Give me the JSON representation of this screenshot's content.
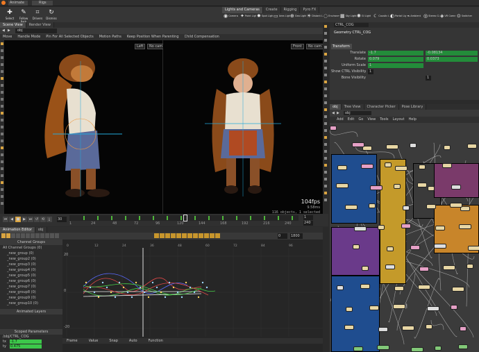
{
  "menubar": {
    "project": "Animate",
    "desktop": "Rigs"
  },
  "shelf": {
    "tools": [
      {
        "icon": "✚",
        "label": "Select"
      },
      {
        "icon": "✎",
        "label": "Follow Path"
      },
      {
        "icon": "⌗",
        "label": "Drivers"
      },
      {
        "icon": "↻",
        "label": "Dismiss"
      }
    ],
    "light_tabs": [
      "Lights and Cameras",
      "Create",
      "Rigging",
      "Pyro FX"
    ],
    "lights": [
      {
        "icon": "◉",
        "label": "Camera"
      },
      {
        "icon": "✦",
        "label": "Point Light"
      },
      {
        "icon": "✸",
        "label": "Spot Light"
      },
      {
        "icon": "▭",
        "label": "Area Light"
      },
      {
        "icon": "⊕",
        "label": "Geo Light"
      },
      {
        "icon": "☀",
        "label": "Distant Light"
      },
      {
        "icon": "◌",
        "label": "Environment Light"
      },
      {
        "icon": "▦",
        "label": "Sky Light"
      },
      {
        "icon": "✺",
        "label": "GI Light"
      },
      {
        "icon": "☾",
        "label": "Caustic Light"
      },
      {
        "icon": "◐",
        "label": "Portal Light"
      },
      {
        "icon": "⌁",
        "label": "Ambient Light"
      },
      {
        "icon": "◎",
        "label": "Stereo Camera"
      },
      {
        "icon": "◈",
        "label": "VR Camera"
      },
      {
        "icon": "⊙",
        "label": "Switcher"
      }
    ]
  },
  "viewport": {
    "tabs": [
      "Scene View",
      "Render View"
    ],
    "path": "obj",
    "options": [
      "Move",
      "Handle Mode",
      "Pin For All Selected Objects",
      "Motion Paths",
      "Keep Position When Parenting",
      "Child Compensation"
    ],
    "left_cam": "Left",
    "left_display": "No cam",
    "right_cam": "Front",
    "right_display": "No cam",
    "fps": "104fps",
    "time": "9.58ms",
    "selection_info": "116 objects, 1 selected"
  },
  "timeline": {
    "frame": "30",
    "start": "1",
    "end": "240",
    "ticks": [
      "1",
      "24",
      "48",
      "72",
      "96",
      "120",
      "144",
      "168",
      "192",
      "216",
      "240"
    ]
  },
  "channel_editor": {
    "tabs": [
      "Animation Editor",
      "obj"
    ],
    "range_start": "0",
    "range_end": "1800",
    "list_header": "Channel Groups",
    "groups": [
      "All Channel Groups (0)",
      "_new_group (0)",
      "_new_group2 (0)",
      "_new_group3 (0)",
      "_new_group4 (0)",
      "_new_group5 (0)",
      "_new_group6 (0)",
      "_new_group7 (0)",
      "_new_group8 (0)",
      "_new_group9 (0)",
      "_new_group10 (0)"
    ],
    "animated_layers": "Animated Layers",
    "scoped_params": "Scoped Parameters",
    "ctrl_path": "/obj/CTRL_COG",
    "params": [
      {
        "name": "tx",
        "value": "-1.7"
      },
      {
        "name": "ty",
        "value": "0.475"
      }
    ],
    "y_labels": [
      "20",
      "0",
      "-20"
    ],
    "x_ticks": [
      "0",
      "12",
      "24",
      "36",
      "48",
      "60",
      "72",
      "84",
      "96"
    ],
    "curve_colors": [
      "#e04848",
      "#48d048",
      "#5a6aff",
      "#e8e8e8"
    ],
    "bottom_buttons": [
      "Frame",
      "Value",
      "Snap",
      "Auto",
      "Function"
    ]
  },
  "parameters": {
    "path": "CTRL_COG",
    "node_title": "Geometry CTRL_COG",
    "tab": "Transform",
    "rows": [
      {
        "label": "Translate",
        "a": "-1.7",
        "b": "-0.08134"
      },
      {
        "label": "Rotate",
        "a": "0.079",
        "b": "0.0373"
      },
      {
        "label": "Uniform Scale",
        "a": "1",
        "b": ""
      },
      {
        "label": "Show CTRL Visibility",
        "a": "1",
        "b": ""
      },
      {
        "label": "Bone Visibility",
        "a": "",
        "b": "1"
      }
    ]
  },
  "network": {
    "tabs": [
      "obj",
      "Tree View",
      "Character Picker",
      "Pose Library"
    ],
    "path": "obj",
    "menu": [
      "Add",
      "Edit",
      "Go",
      "View",
      "Tools",
      "Layout",
      "Help"
    ]
  }
}
